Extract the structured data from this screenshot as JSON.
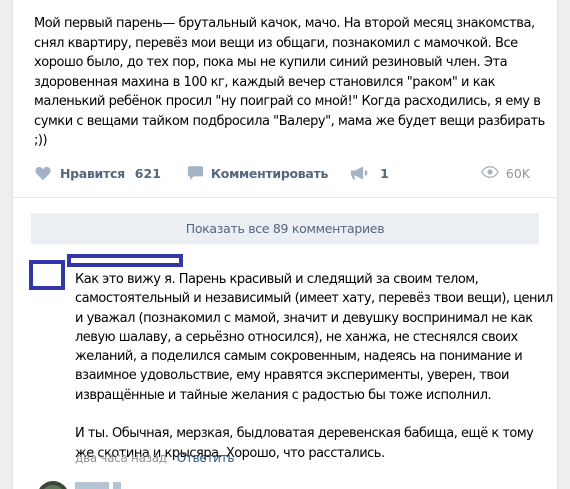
{
  "post": {
    "text": "Мой первый парень— брутальный качок, мачо. На второй месяц знакомства, снял квартиру, перевёз мои вещи из общаги, познакомил с мамочкой. Все хорошо было, до тех пор, пока мы не купили синий резиновый член. Эта здоровенная махина в 100 кг, каждый вечер становился \"раком\" и как маленький ребёнок просил \"ну поиграй со мной!\" Когда расходились, я ему в сумки с вещами тайком подбросила \"Валеру\", мама же будет вещи разбирать ;))"
  },
  "actions": {
    "like_label": "Нравится",
    "like_count": "621",
    "comment_label": "Комментировать",
    "share_count": "1",
    "views_count": "60K"
  },
  "comments": {
    "show_all_label": "Показать все 89 комментариев",
    "items": [
      {
        "text": "Как это вижу я. Парень красивый и следящий за своим телом, самостоятельный и независимый (имеет хату, перевёз твои вещи), ценил и уважал (познакомил с мамой, значит и девушку воспринимал не как левую шалаву, а серьёзно относился), не ханжа, не стеснялся своих желаний, а поделился самым сокровенным, надеясь на понимание и взаимное удовольствие, ему нравятся эксперименты, уверен, твои извращённые и тайные желания с радостью бы тоже исполнил.\n\nИ ты. Обычная, мерзкая, быдловатая деревенская бабища, ещё к тому же скотина и крысяра. Хорошо, что расстались.",
        "time": "два часа назад",
        "reply_label": "Ответить"
      }
    ]
  },
  "colors": {
    "link": "#2a5885",
    "action_gray": "#55677d",
    "redaction_box": "#3336a8",
    "muted": "#939393"
  },
  "icons": {
    "like": "heart-icon",
    "comment": "speech-bubble-icon",
    "share": "megaphone-icon",
    "views": "eye-icon"
  }
}
